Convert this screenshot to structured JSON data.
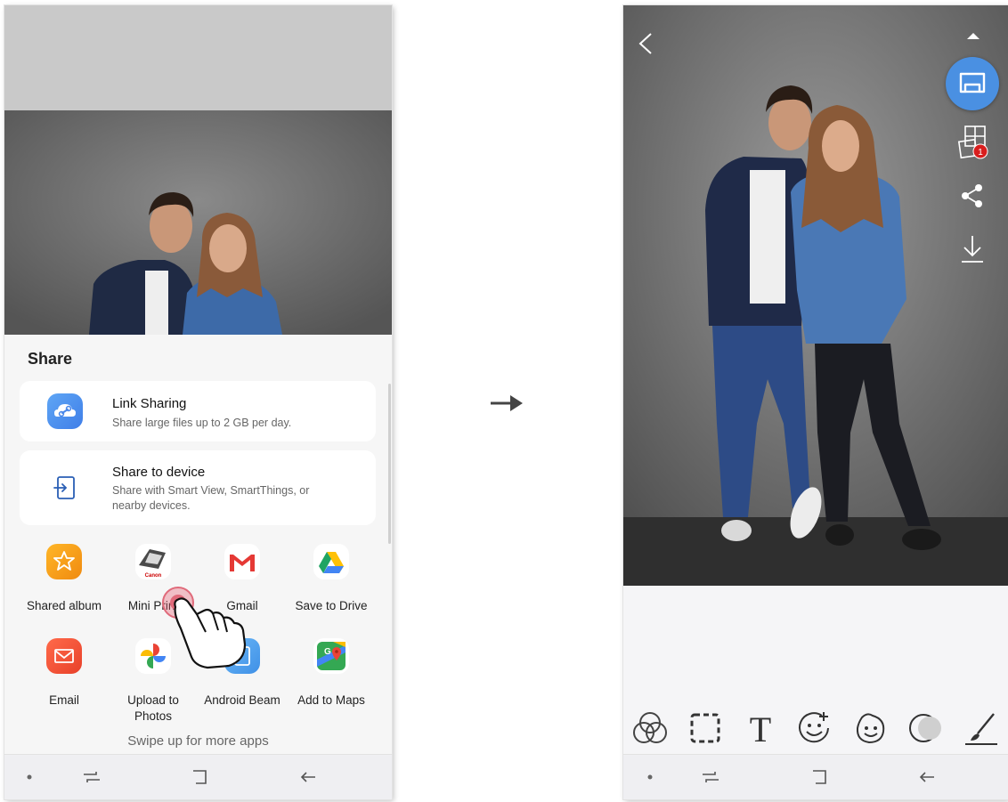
{
  "share_sheet": {
    "title": "Share",
    "link_sharing": {
      "title": "Link Sharing",
      "subtitle": "Share large files up to 2 GB per day."
    },
    "share_to_device": {
      "title": "Share to device",
      "subtitle": "Share with Smart View, SmartThings, or nearby devices."
    },
    "apps": [
      {
        "label": "Shared album",
        "icon": "shared-album-icon",
        "color": "#f7a21b"
      },
      {
        "label": "Mini Print",
        "icon": "canon-mini-print-icon",
        "color": "#555555"
      },
      {
        "label": "Gmail",
        "icon": "gmail-icon",
        "color": "#ea4335"
      },
      {
        "label": "Save to Drive",
        "icon": "google-drive-icon",
        "color": "#1fa463"
      },
      {
        "label": "Email",
        "icon": "email-icon",
        "color": "#f0543c"
      },
      {
        "label": "Upload to Photos",
        "icon": "google-photos-icon",
        "color": "#4285f4"
      },
      {
        "label": "Android Beam",
        "icon": "android-beam-icon",
        "color": "#4aa3f0"
      },
      {
        "label": "Add to Maps",
        "icon": "google-maps-icon",
        "color": "#34a853"
      }
    ],
    "swipe_hint": "Swipe up for more apps",
    "canon_text": "Canon"
  },
  "editor": {
    "side_icons": [
      "back-icon",
      "collapse-icon",
      "print-icon",
      "tile-print-icon",
      "share-icon",
      "download-icon"
    ],
    "tile_badge": "1",
    "tools": [
      "filters-icon",
      "frame-icon",
      "text-icon",
      "sticker-icon",
      "face-sticker-icon",
      "blur-icon",
      "draw-icon"
    ],
    "accent": "#4a90e2"
  }
}
